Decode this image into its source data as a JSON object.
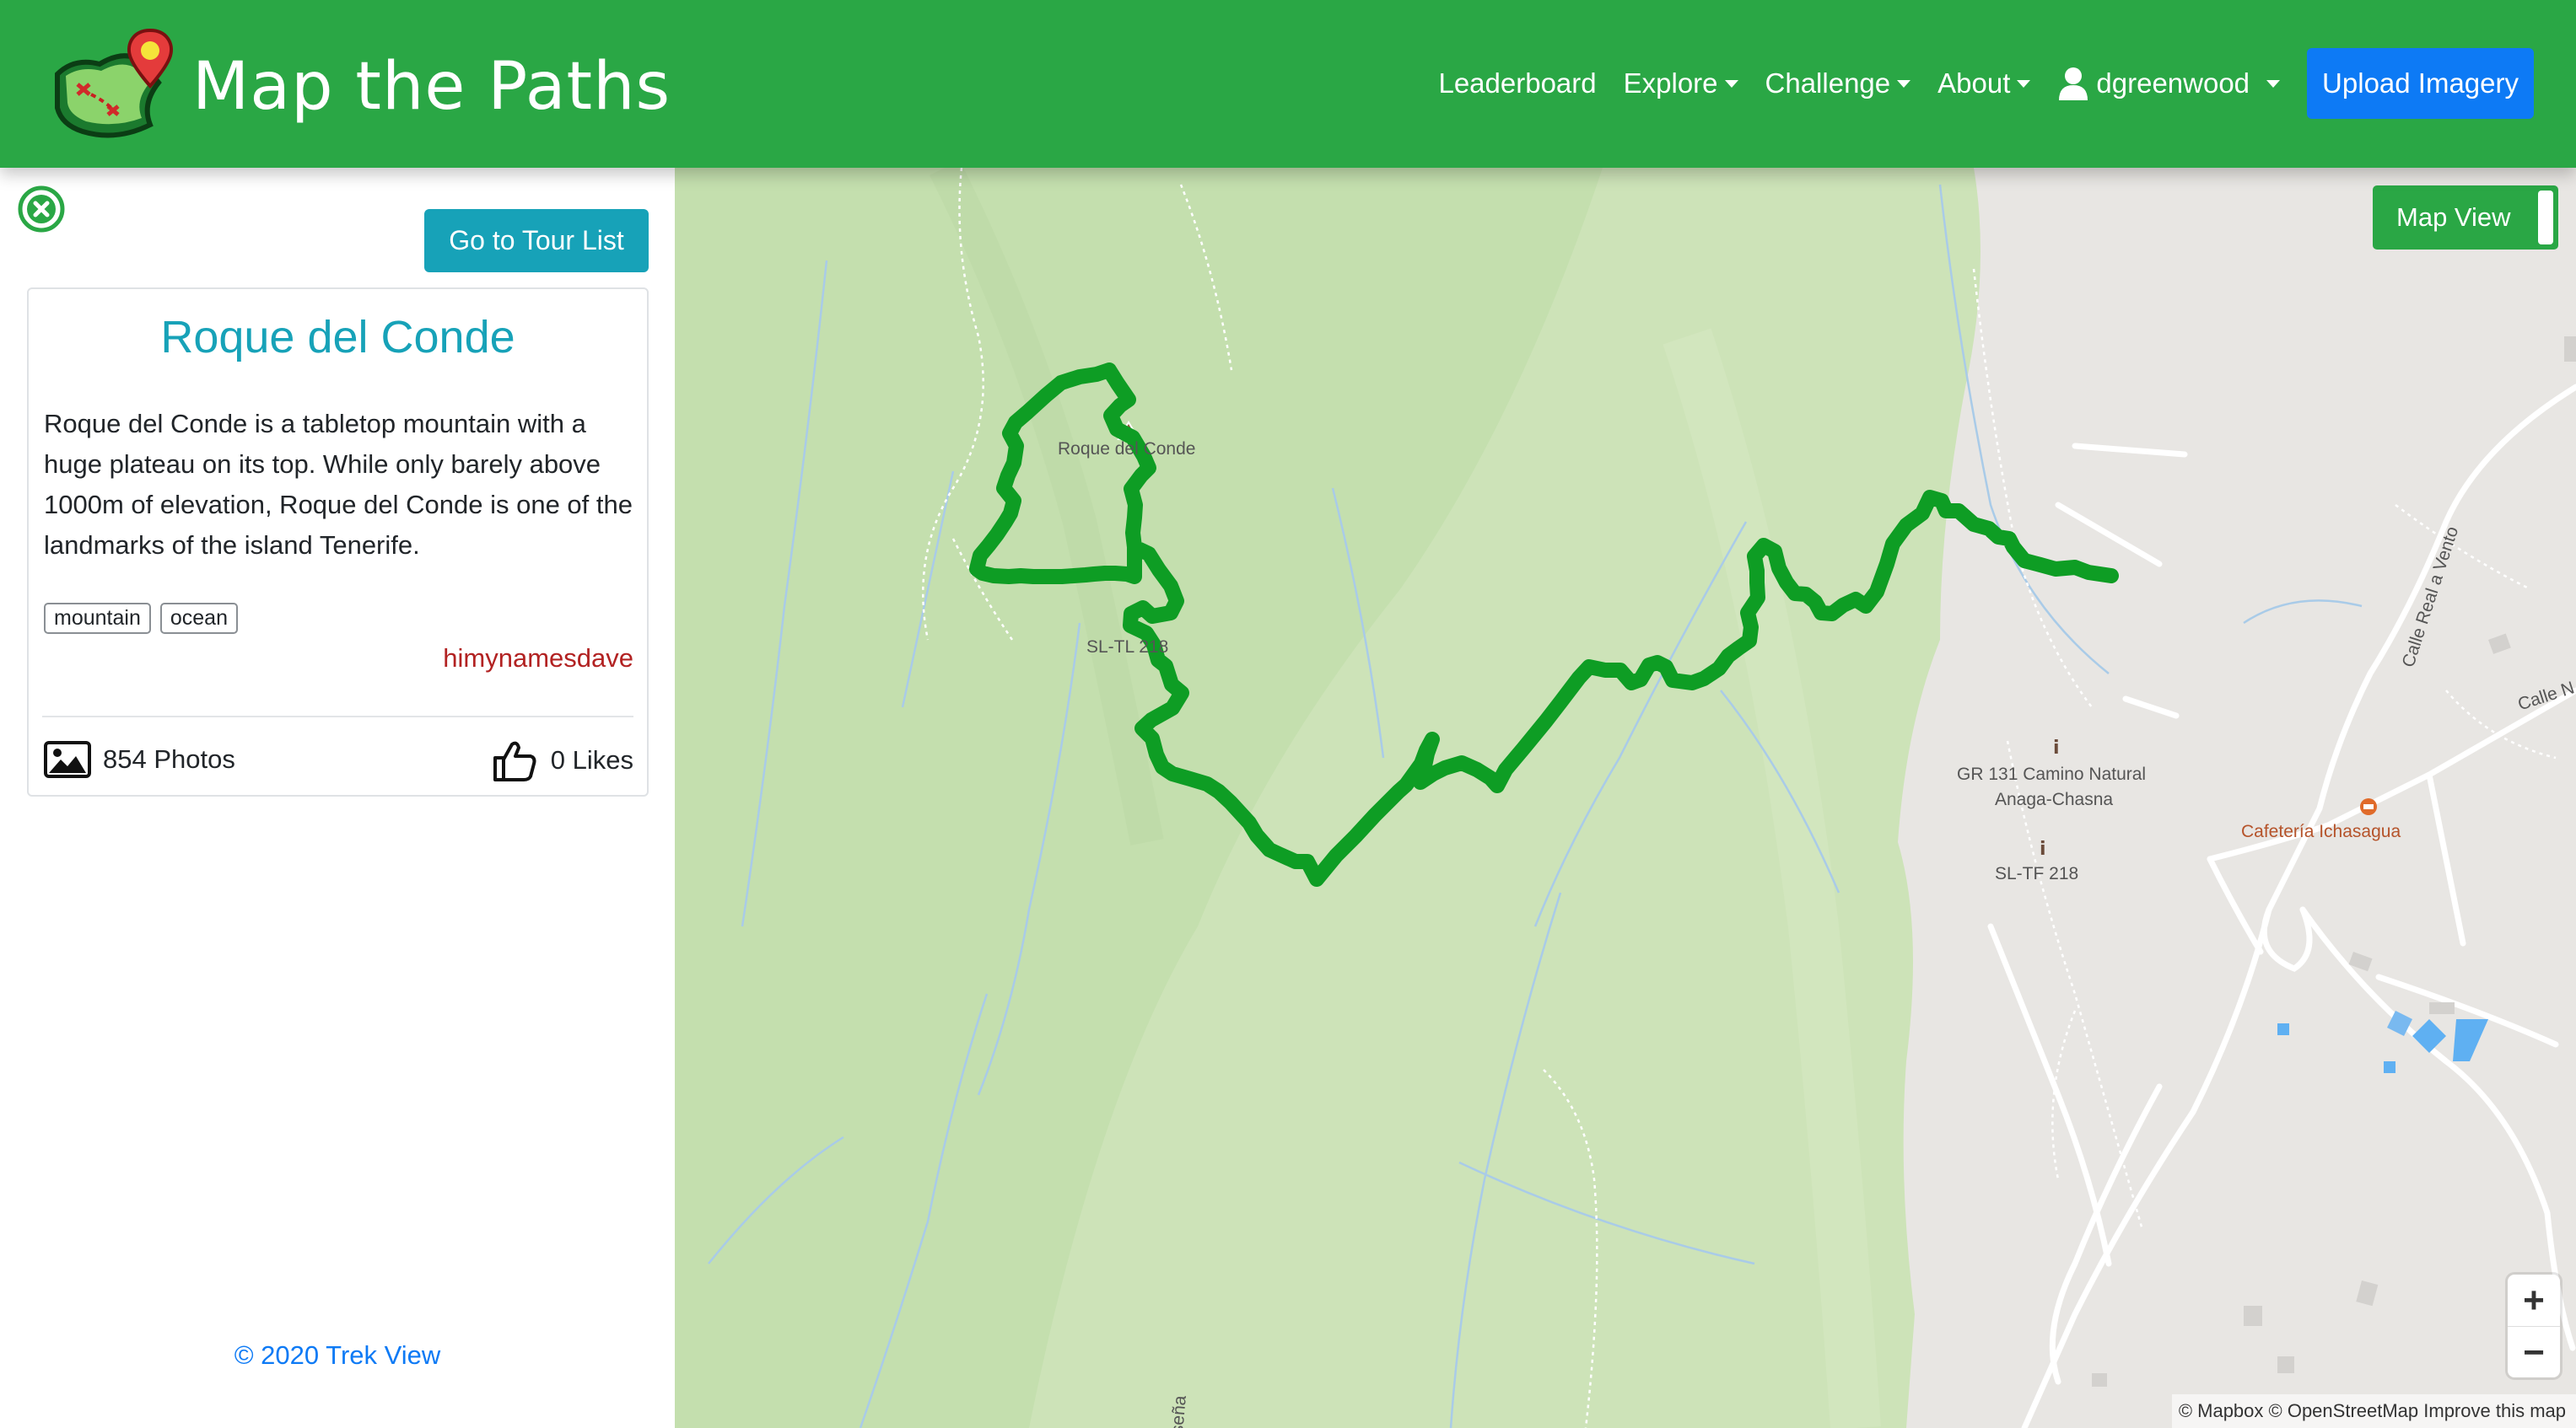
{
  "header": {
    "brand_title": "Map the Paths",
    "nav": {
      "leaderboard": "Leaderboard",
      "explore": "Explore",
      "challenge": "Challenge",
      "about": "About",
      "user": "dgreenwood"
    },
    "upload_button": "Upload Imagery",
    "colors": {
      "navbar": "#2aa745",
      "upload": "#0d7af5"
    }
  },
  "sidebar": {
    "tour_list_button": "Go to Tour List",
    "tour": {
      "title": "Roque del Conde",
      "description": "Roque del Conde is a tabletop mountain with a huge plateau on its top. While only barely above 1000m of elevation, Roque del Conde is one of the landmarks of the island Tenerife.",
      "tags": [
        "mountain",
        "ocean"
      ],
      "author": "himynamesdave",
      "photos": "854 Photos",
      "likes": "0 Likes"
    },
    "footer": "© 2020 Trek View"
  },
  "map": {
    "view_toggle": "Map View",
    "zoom_in": "+",
    "zoom_out": "−",
    "attribution": "© Mapbox © OpenStreetMap Improve this map",
    "labels": {
      "summit": "Roque del Conde",
      "trail_start": "SL-TL 218",
      "trail_gr": "GR 131 Camino Natural",
      "trail_gr_2": "Anaga-Chasna",
      "trail_sl": "SL-TF 218",
      "cafe": "Cafetería Ichasagua",
      "road_1": "Calle Real a Vento",
      "road_2": "Calle N",
      "road_3": "seña"
    },
    "route_color": "#0e9d24"
  }
}
